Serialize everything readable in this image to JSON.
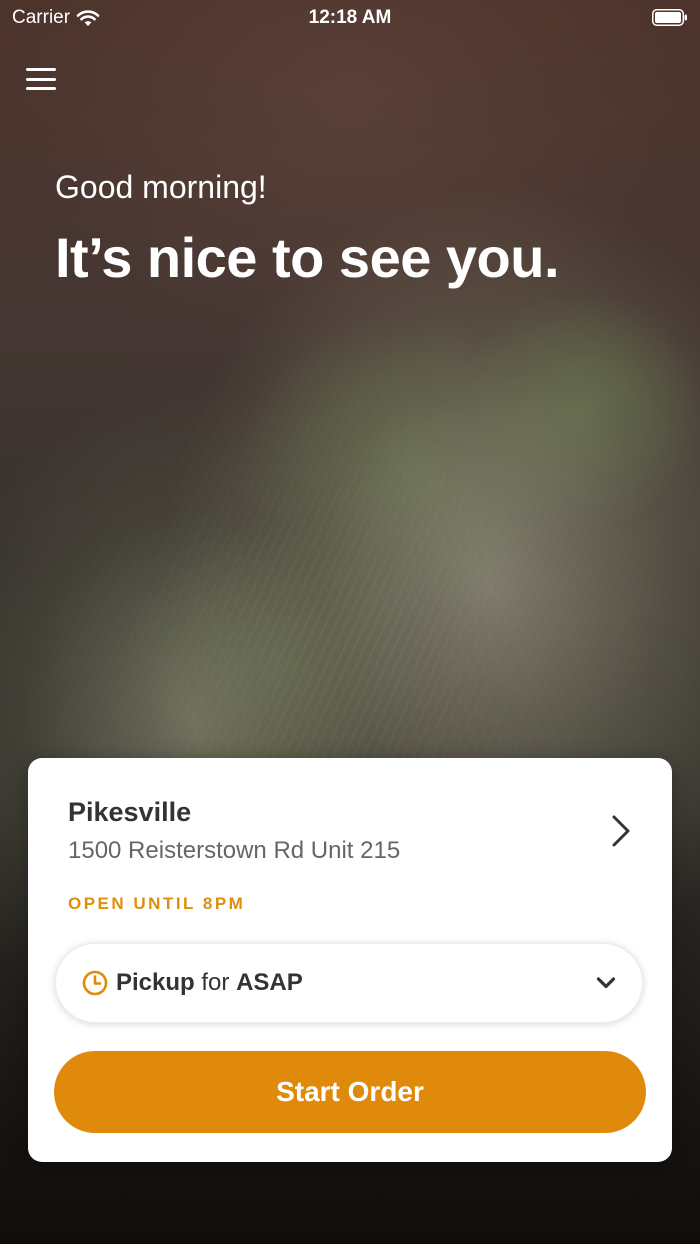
{
  "status_bar": {
    "carrier": "Carrier",
    "time": "12:18 AM"
  },
  "header": {
    "menu_icon": "hamburger-menu-icon"
  },
  "greeting": {
    "subtitle": "Good morning!",
    "title": "It’s nice to see you."
  },
  "location_card": {
    "store_name": "Pikesville",
    "address": "1500 Reisterstown Rd Unit 215",
    "hours": "OPEN UNTIL 8PM",
    "order_mode": {
      "mode": "Pickup",
      "connector": "for",
      "time": "ASAP"
    },
    "start_button": "Start Order"
  },
  "colors": {
    "accent": "#df8a0b",
    "status_text": "#e08f0a",
    "text_dark": "#333333",
    "text_muted": "#666666"
  }
}
